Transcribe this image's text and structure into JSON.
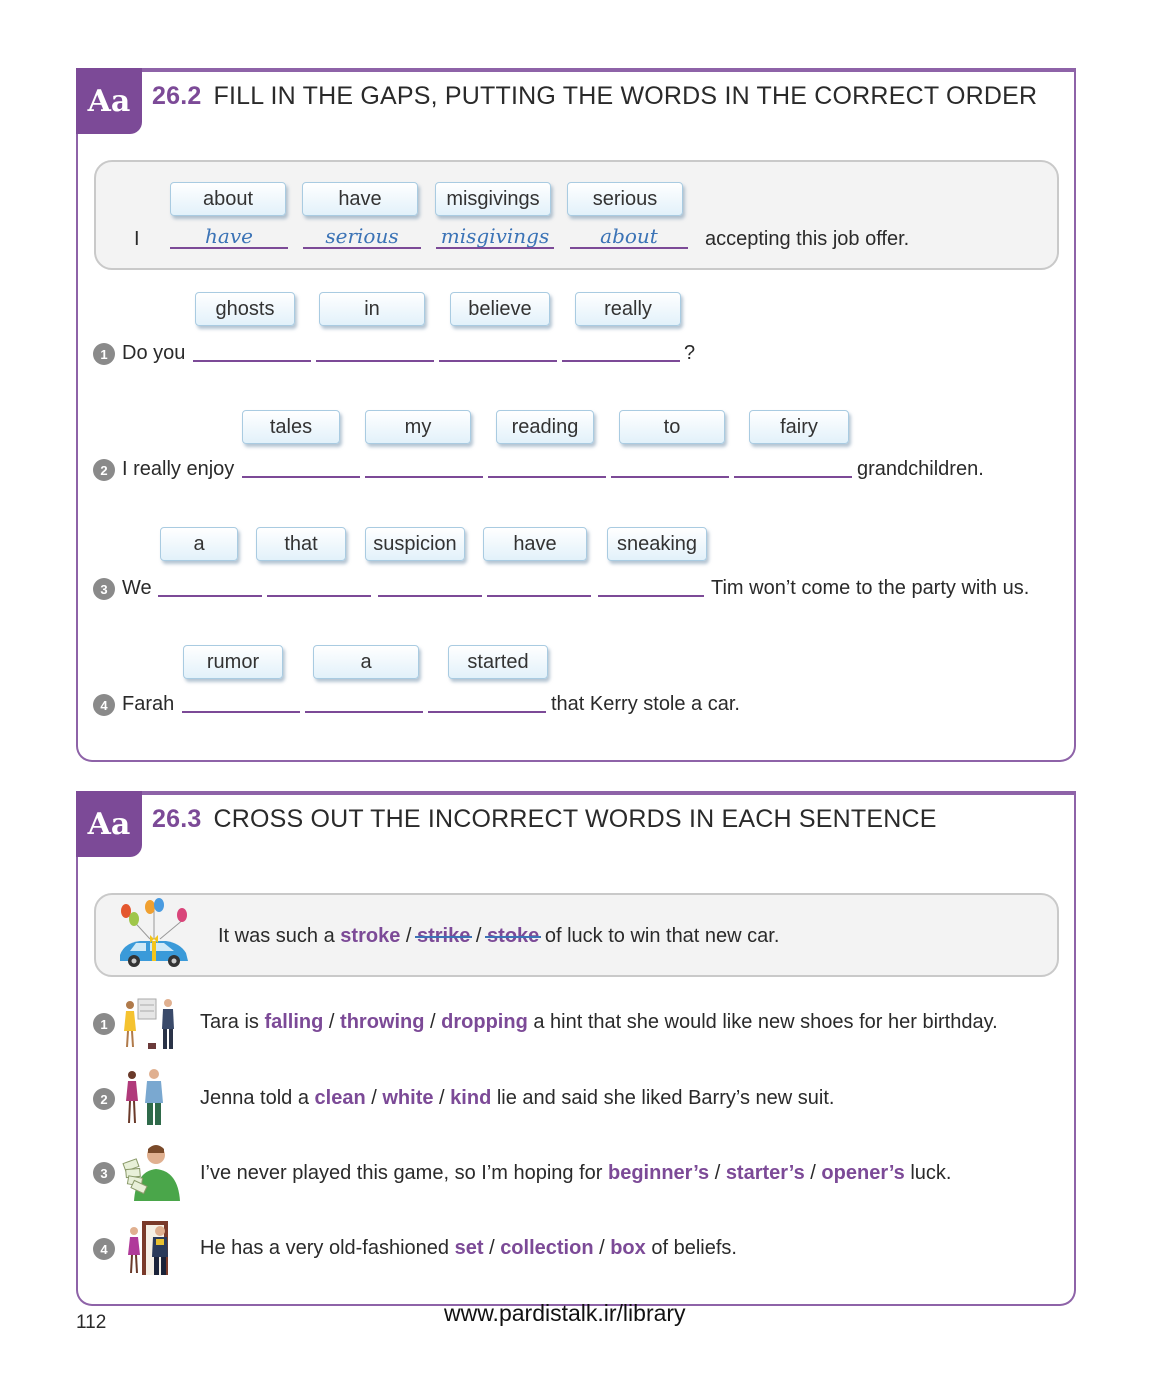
{
  "exercise1": {
    "badge": "Aa",
    "number": "26.2",
    "title": "FILL IN THE GAPS, PUTTING THE WORDS IN THE CORRECT ORDER",
    "example": {
      "chips": [
        "about",
        "have",
        "misgivings",
        "serious"
      ],
      "prefix": "I",
      "answers": [
        "have",
        "serious",
        "misgivings",
        "about"
      ],
      "suffix": "accepting this job offer."
    },
    "items": [
      {
        "num": "1",
        "chips": [
          "ghosts",
          "in",
          "believe",
          "really"
        ],
        "prefix": "Do you",
        "suffix": "?"
      },
      {
        "num": "2",
        "chips": [
          "tales",
          "my",
          "reading",
          "to",
          "fairy"
        ],
        "prefix": "I really enjoy",
        "suffix": "grandchildren."
      },
      {
        "num": "3",
        "chips": [
          "a",
          "that",
          "suspicion",
          "have",
          "sneaking"
        ],
        "prefix": "We",
        "suffix": "Tim won’t come to the party with us."
      },
      {
        "num": "4",
        "chips": [
          "rumor",
          "a",
          "started"
        ],
        "prefix": "Farah",
        "suffix": "that Kerry stole a car."
      }
    ]
  },
  "exercise2": {
    "badge": "Aa",
    "number": "26.3",
    "title": "CROSS OUT THE INCORRECT WORDS IN EACH SENTENCE",
    "example": {
      "before": "It was such a",
      "options": [
        "stroke",
        "strike",
        "stoke"
      ],
      "crossed": [
        false,
        true,
        true
      ],
      "after": "of luck to win that new car.",
      "image_icon": "car-with-balloons-icon"
    },
    "items": [
      {
        "num": "1",
        "before": "Tara is",
        "options": [
          "falling",
          "throwing",
          "dropping"
        ],
        "after": "a hint that she would like new shoes for her birthday.",
        "image_icon": "couple-shoe-shop-icon"
      },
      {
        "num": "2",
        "before": "Jenna told a",
        "options": [
          "clean",
          "white",
          "kind"
        ],
        "after": "lie and said she liked Barry’s new suit.",
        "image_icon": "woman-and-man-in-suit-icon"
      },
      {
        "num": "3",
        "before": "I’ve never played this game, so I’m hoping for",
        "options": [
          "beginner’s",
          "starter’s",
          "opener’s"
        ],
        "after": "luck.",
        "image_icon": "man-holding-money-icon"
      },
      {
        "num": "4",
        "before": "He has a very old-fashioned",
        "options": [
          "set",
          "collection",
          "box"
        ],
        "after": "of beliefs.",
        "image_icon": "couple-at-door-icon"
      }
    ]
  },
  "footer": {
    "page_number": "112",
    "url": "www.pardistalk.ir/library"
  },
  "colors": {
    "accent": "#7c4a97",
    "answer": "#3b73b6",
    "chip_border": "#a9cbe1"
  }
}
